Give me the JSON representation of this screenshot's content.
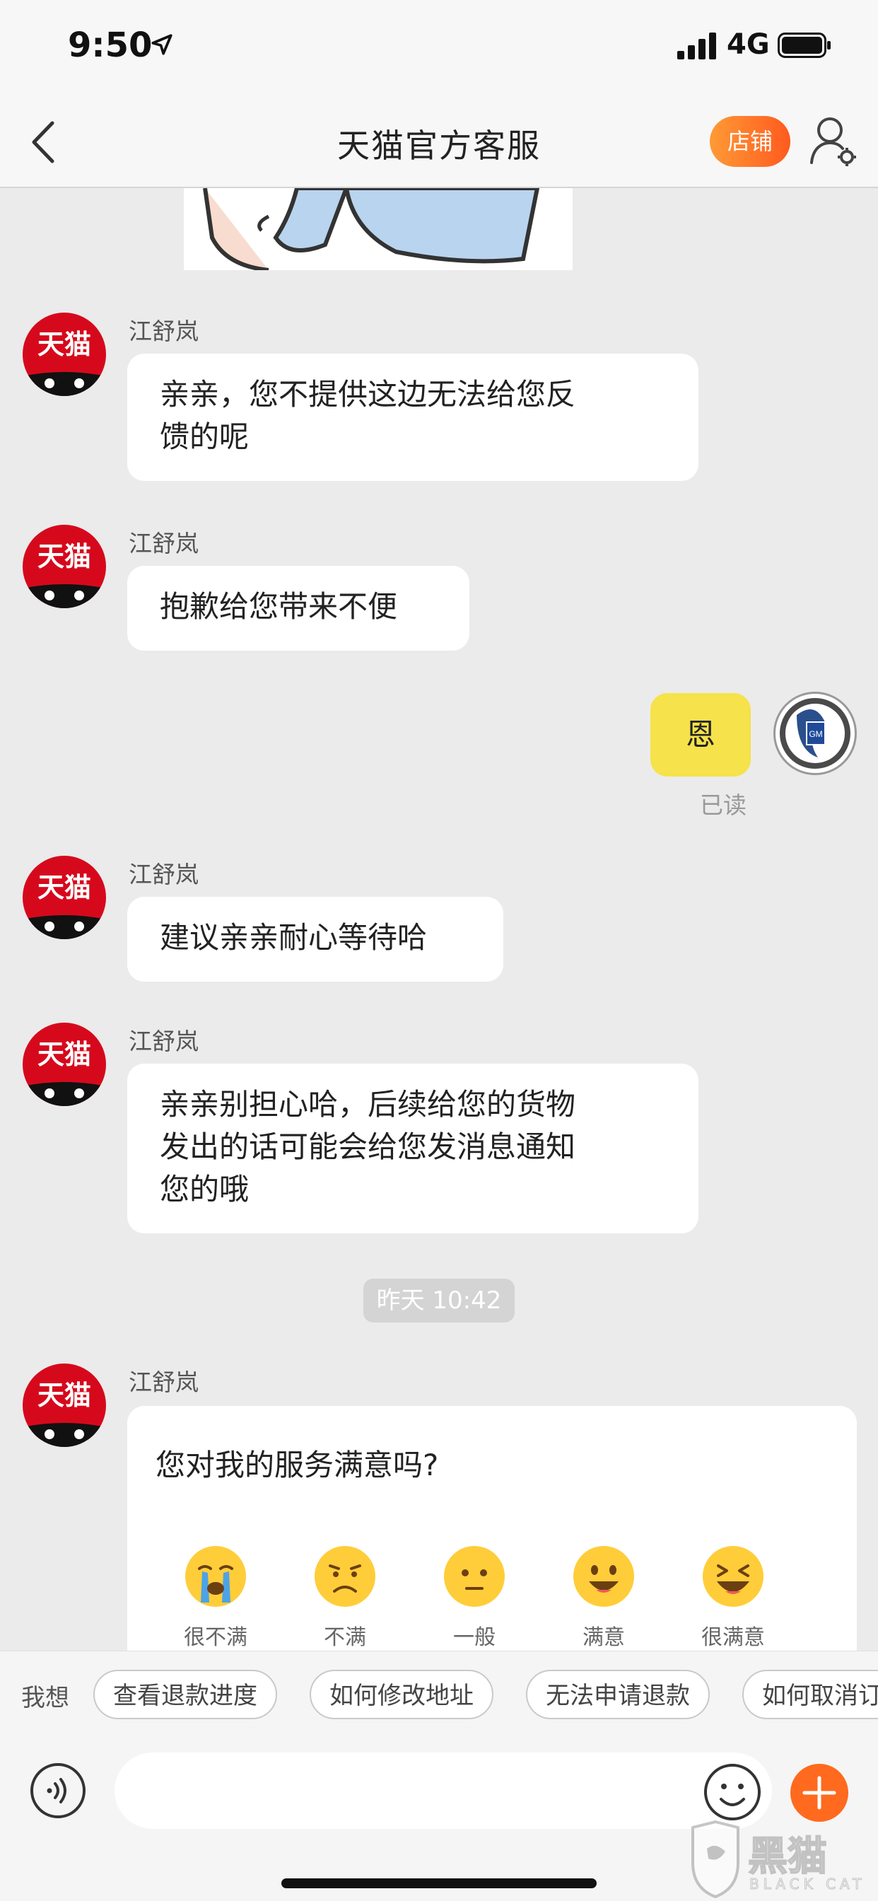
{
  "status_bar": {
    "time": "9:50",
    "network": "4G"
  },
  "nav": {
    "title": "天猫官方客服",
    "store_button": "店铺"
  },
  "agent": {
    "avatar_text": "天猫",
    "name": "江舒岚"
  },
  "messages": [
    {
      "text": "亲亲，您不提供这边无法给您反\n馈的呢"
    },
    {
      "text": "抱歉给您带来不便"
    },
    {
      "text": "恩",
      "read_status": "已读"
    },
    {
      "text": "建议亲亲耐心等待哈"
    },
    {
      "text": "亲亲别担心哈，后续给您的货物\n发出的话可能会给您发消息通知\n您的哦"
    }
  ],
  "time_divider": "昨天 10:42",
  "survey": {
    "question": "您对我的服务满意吗?",
    "options": [
      "很不满",
      "不满",
      "一般",
      "满意",
      "很满意"
    ]
  },
  "quick_replies": {
    "label": "我想",
    "items": [
      "查看退款进度",
      "如何修改地址",
      "无法申请退款",
      "如何取消订单"
    ]
  },
  "watermark": {
    "text": "黑猫",
    "sub": "BLACK CAT"
  },
  "colors": {
    "accent": "#ff6a1e",
    "brand": "#d6091c",
    "self_bubble": "#f6e24a"
  },
  "icons": [
    "location-arrow-icon",
    "signal-icon",
    "battery-icon",
    "back-icon",
    "profile-settings-icon",
    "voice-icon",
    "emoji-icon",
    "plus-icon"
  ]
}
